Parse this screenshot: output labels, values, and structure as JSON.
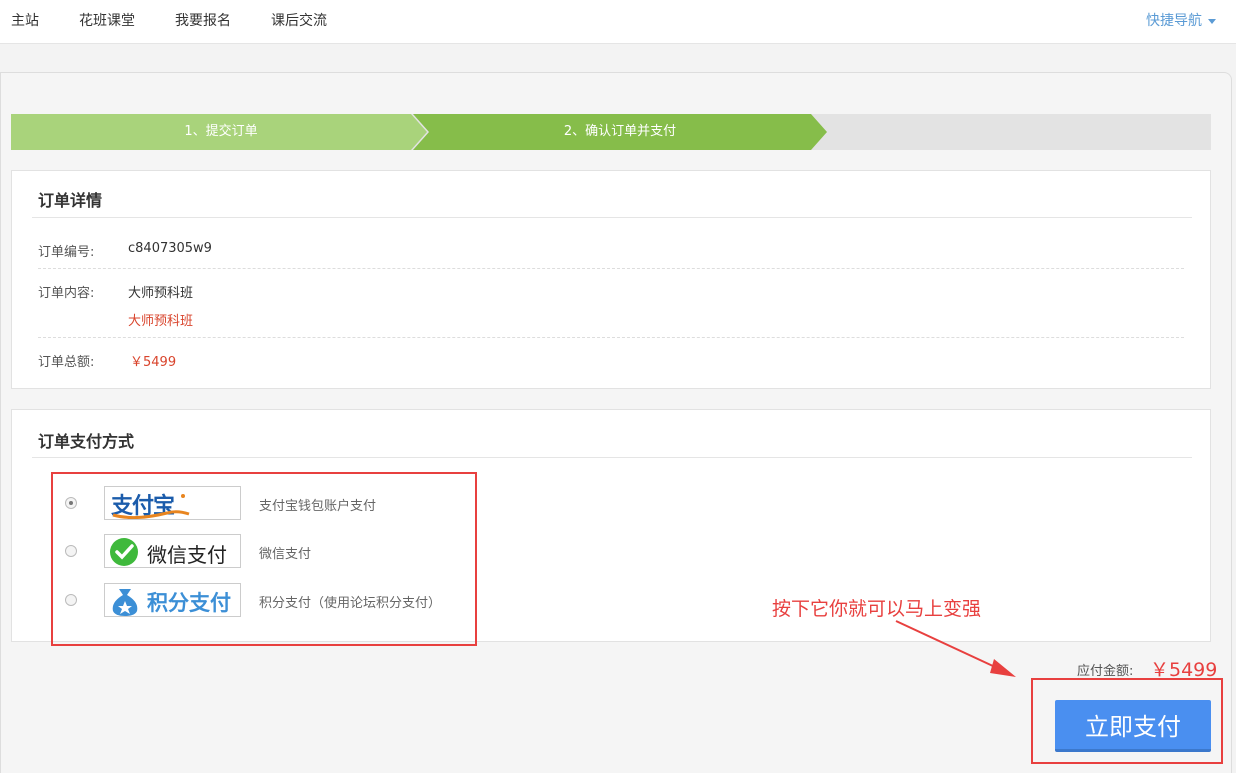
{
  "topnav": {
    "items": [
      "主站",
      "花班课堂",
      "我要报名",
      "课后交流"
    ],
    "quick_nav": "快捷导航"
  },
  "steps": [
    "1、提交订单",
    "2、确认订单并支付"
  ],
  "order": {
    "title": "订单详情",
    "number_label": "订单编号:",
    "number_value": "c8407305w9",
    "content_label": "订单内容:",
    "content_value": "大师预科班",
    "content_sub": "大师预科班",
    "total_label": "订单总额:",
    "total_value": "￥5499"
  },
  "payment": {
    "title": "订单支付方式",
    "options": [
      {
        "logo": "支付宝",
        "desc": "支付宝钱包账户支付",
        "selected": true,
        "icon": "alipay-logo"
      },
      {
        "logo": "微信支付",
        "desc": "微信支付",
        "selected": false,
        "icon": "wechat-pay-logo"
      },
      {
        "logo": "积分支付",
        "desc": "积分支付（使用论坛积分支付）",
        "selected": false,
        "icon": "points-pay-logo"
      }
    ]
  },
  "annotation": "按下它你就可以马上变强",
  "summary": {
    "amount_label": "应付金额:",
    "amount_value": "￥5499",
    "pay_button": "立即支付"
  },
  "colors": {
    "accent_blue": "#4a8ff0",
    "step_light_green": "#a9d37b",
    "step_green": "#86bd4a",
    "price_red": "#d9442c",
    "annotation_red": "#e8403f"
  }
}
